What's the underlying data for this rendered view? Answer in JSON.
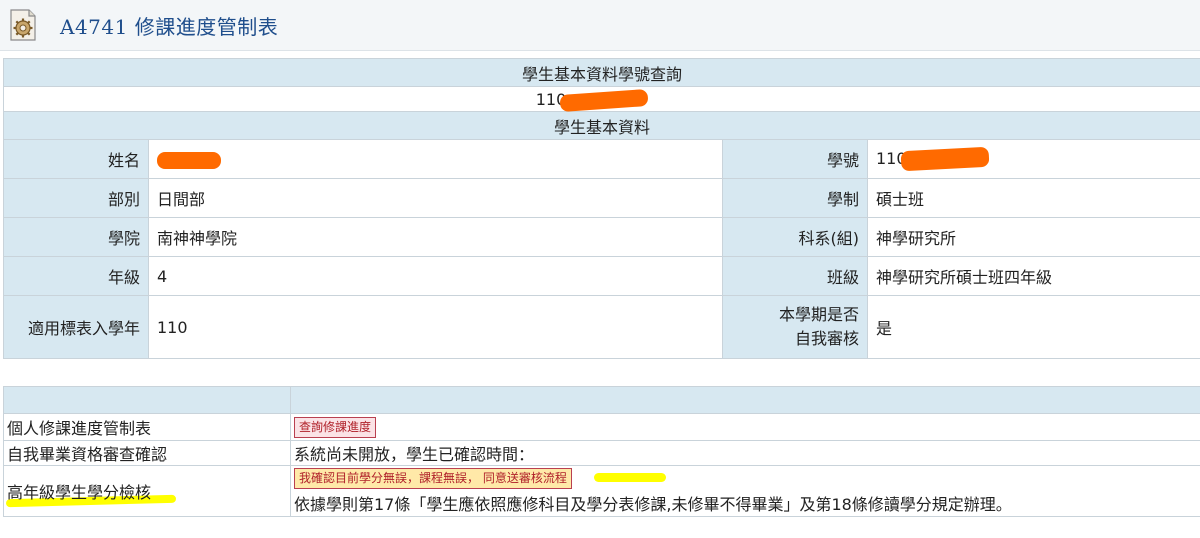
{
  "header": {
    "title": "A4741 修課進度管制表"
  },
  "search": {
    "heading": "學生基本資料學號查詢",
    "student_id_visible": "110"
  },
  "profile": {
    "heading": "學生基本資料",
    "name_label": "姓名",
    "name_value": "",
    "sid_label": "學號",
    "sid_value": "110",
    "division_label": "部別",
    "division_value": "日間部",
    "system_label": "學制",
    "system_value": "碩士班",
    "college_label": "學院",
    "college_value": "南神神學院",
    "dept_label": "科系(組)",
    "dept_value": "神學研究所",
    "grade_label": "年級",
    "grade_value": "4",
    "class_label": "班級",
    "class_value": "神學研究所碩士班四年級",
    "entry_year_label": "適用標表入學年",
    "entry_year_value": "110",
    "self_review_label_line1": "本學期是否",
    "self_review_label_line2": "自我審核",
    "self_review_value": "是"
  },
  "actions": {
    "row1_label": "個人修課進度管制表",
    "row1_button": "查詢修課進度",
    "row2_label": "自我畢業資格審查確認",
    "row2_text": "系統尚未開放，學生已確認時間：",
    "row3_label": "高年級學生學分檢核",
    "row3_button": "我確認目前學分無誤，課程無誤， 同意送審核流程",
    "row3_note": "依據學則第17條「學生應依照應修科目及學分表修課,未修畢不得畢業」及第18條修讀學分規定辦理。"
  },
  "colors": {
    "header_bg": "#d7e8f1",
    "title_blue": "#1f4e8c",
    "button_red": "#b0212a",
    "redaction": "#ff6a00",
    "highlight": "#ffff00"
  }
}
